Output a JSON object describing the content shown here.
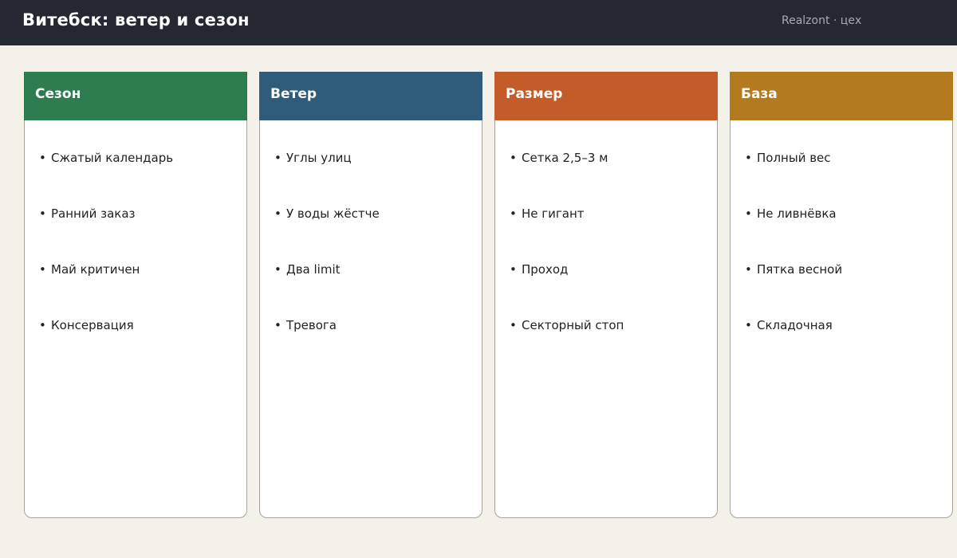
{
  "header": {
    "title": "Витебск: ветер и сезон",
    "brand": "Realzont · цех"
  },
  "columns": [
    {
      "label": "Сезон",
      "color": "#2e7d51",
      "items": [
        "Сжатый календарь",
        "Ранний заказ",
        "Май критичен",
        "Консервация"
      ]
    },
    {
      "label": "Ветер",
      "color": "#2e5c7a",
      "items": [
        "Углы улиц",
        "У воды жёстче",
        "Два limit",
        "Тревога"
      ]
    },
    {
      "label": "Размер",
      "color": "#c45c2a",
      "items": [
        "Сетка 2,5–3 м",
        "Не гигант",
        "Проход",
        "Секторный стоп"
      ]
    },
    {
      "label": "База",
      "color": "#b47a1f",
      "items": [
        "Полный вес",
        "Не ливнёвка",
        "Пятка весной",
        "Складочная"
      ]
    }
  ]
}
